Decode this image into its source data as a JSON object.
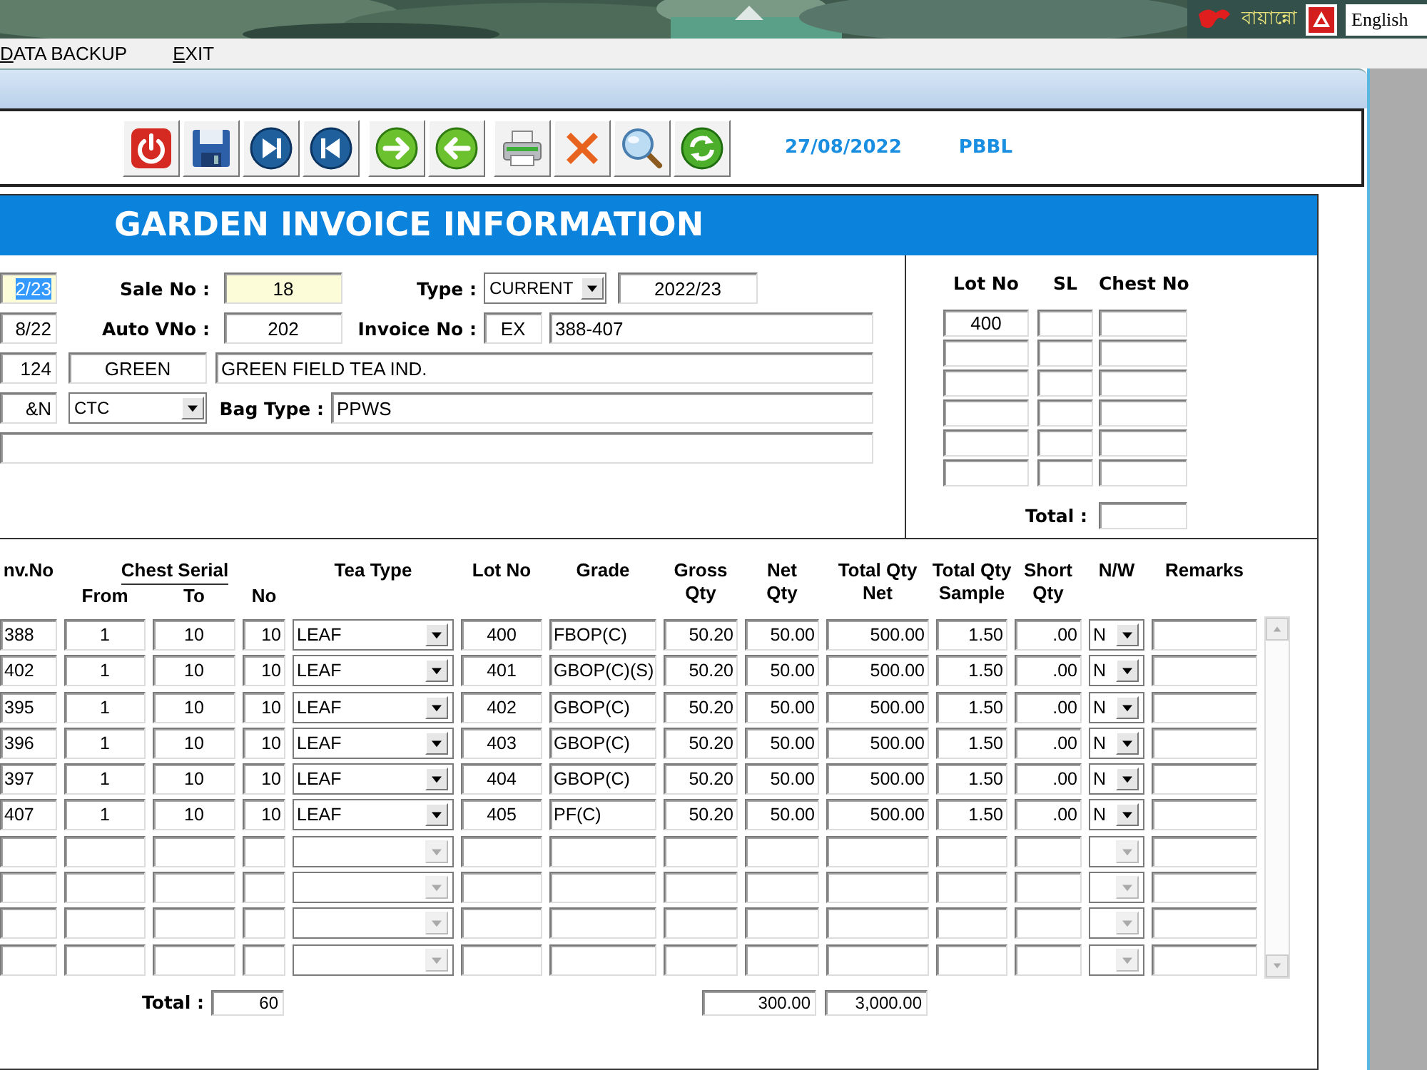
{
  "desktop": {
    "brand": "বায়ান্নো",
    "language": "English"
  },
  "menu": [
    {
      "label": "DATA BACKUP"
    },
    {
      "label": "EXIT"
    }
  ],
  "toolbar": {
    "buttons": [
      {
        "kind": "power"
      },
      {
        "kind": "save"
      },
      {
        "kind": "last"
      },
      {
        "kind": "first"
      },
      {
        "kind": "forward"
      },
      {
        "kind": "back"
      },
      {
        "kind": "print"
      },
      {
        "kind": "delete"
      },
      {
        "kind": "search"
      },
      {
        "kind": "refresh"
      }
    ],
    "date": "27/08/2022",
    "company": "PBBL"
  },
  "title": "GARDEN INVOICE INFORMATION",
  "header": {
    "left_column": [
      {
        "value": "2/23",
        "tinted": true,
        "text_selected": true
      },
      {
        "value": "8/22",
        "tinted": false,
        "text_selected": false
      },
      {
        "value": "124",
        "tinted": false,
        "text_selected": false
      },
      {
        "value": "&N",
        "tinted": false,
        "text_selected": false
      }
    ],
    "sale_no": {
      "label": "Sale No :",
      "value": "18",
      "tinted": true
    },
    "type": {
      "label": "Type :",
      "value": "CURRENT",
      "season": "2022/23"
    },
    "auto_vno": {
      "label": "Auto VNo :",
      "value": "202"
    },
    "invoice_no": {
      "label": "Invoice No :",
      "prefix": "EX",
      "value": "388-407"
    },
    "garden": {
      "code": "GREEN",
      "name": "GREEN FIELD TEA IND."
    },
    "category": {
      "value": "CTC"
    },
    "bag_type": {
      "label": "Bag Type :",
      "value": "PPWS"
    }
  },
  "lot_panel": {
    "columns": [
      "Lot No",
      "SL",
      "Chest No"
    ],
    "rows": [
      {
        "kind": "filled",
        "lot_no": "400"
      },
      {
        "kind": "blank"
      },
      {
        "kind": "blank"
      },
      {
        "kind": "blank"
      },
      {
        "kind": "blank"
      },
      {
        "kind": "blank"
      }
    ],
    "total_label": "Total :"
  },
  "grid": {
    "chest_serial": "Chest Serial",
    "columns": [
      "nv.No",
      "From",
      "To",
      "No",
      "Tea Type",
      "Lot No",
      "Grade",
      "Gross\nQty",
      "Net\nQty",
      "Total Qty\nNet",
      "Total Qty\nSample",
      "Short\nQty",
      "N/W",
      "Remarks"
    ],
    "rows": [
      {
        "kind": "filled",
        "inv_no": "388",
        "from": "1",
        "to": "10",
        "no": "10",
        "tea_type": "LEAF",
        "lot_no": "400",
        "grade": "FBOP(C)",
        "gross_qty": "50.20",
        "net_qty": "50.00",
        "total_qty_net": "500.00",
        "total_qty_sample": "1.50",
        "short_qty": ".00",
        "nw": "N"
      },
      {
        "kind": "filled",
        "inv_no": "402",
        "from": "1",
        "to": "10",
        "no": "10",
        "tea_type": "LEAF",
        "lot_no": "401",
        "grade": "GBOP(C)(S)",
        "gross_qty": "50.20",
        "net_qty": "50.00",
        "total_qty_net": "500.00",
        "total_qty_sample": "1.50",
        "short_qty": ".00",
        "nw": "N"
      },
      {
        "kind": "filled",
        "inv_no": "395",
        "from": "1",
        "to": "10",
        "no": "10",
        "tea_type": "LEAF",
        "lot_no": "402",
        "grade": "GBOP(C)",
        "gross_qty": "50.20",
        "net_qty": "50.00",
        "total_qty_net": "500.00",
        "total_qty_sample": "1.50",
        "short_qty": ".00",
        "nw": "N"
      },
      {
        "kind": "filled",
        "inv_no": "396",
        "from": "1",
        "to": "10",
        "no": "10",
        "tea_type": "LEAF",
        "lot_no": "403",
        "grade": "GBOP(C)",
        "gross_qty": "50.20",
        "net_qty": "50.00",
        "total_qty_net": "500.00",
        "total_qty_sample": "1.50",
        "short_qty": ".00",
        "nw": "N"
      },
      {
        "kind": "filled",
        "inv_no": "397",
        "from": "1",
        "to": "10",
        "no": "10",
        "tea_type": "LEAF",
        "lot_no": "404",
        "grade": "GBOP(C)",
        "gross_qty": "50.20",
        "net_qty": "50.00",
        "total_qty_net": "500.00",
        "total_qty_sample": "1.50",
        "short_qty": ".00",
        "nw": "N"
      },
      {
        "kind": "filled",
        "inv_no": "407",
        "from": "1",
        "to": "10",
        "no": "10",
        "tea_type": "LEAF",
        "lot_no": "405",
        "grade": "PF(C)",
        "gross_qty": "50.20",
        "net_qty": "50.00",
        "total_qty_net": "500.00",
        "total_qty_sample": "1.50",
        "short_qty": ".00",
        "nw": "N"
      },
      {
        "kind": "blank"
      },
      {
        "kind": "blank"
      },
      {
        "kind": "blank"
      },
      {
        "kind": "blank"
      }
    ],
    "total": {
      "label": "Total :",
      "chests": "60",
      "net_qty": "300.00",
      "total_qty_net": "3,000.00"
    }
  }
}
